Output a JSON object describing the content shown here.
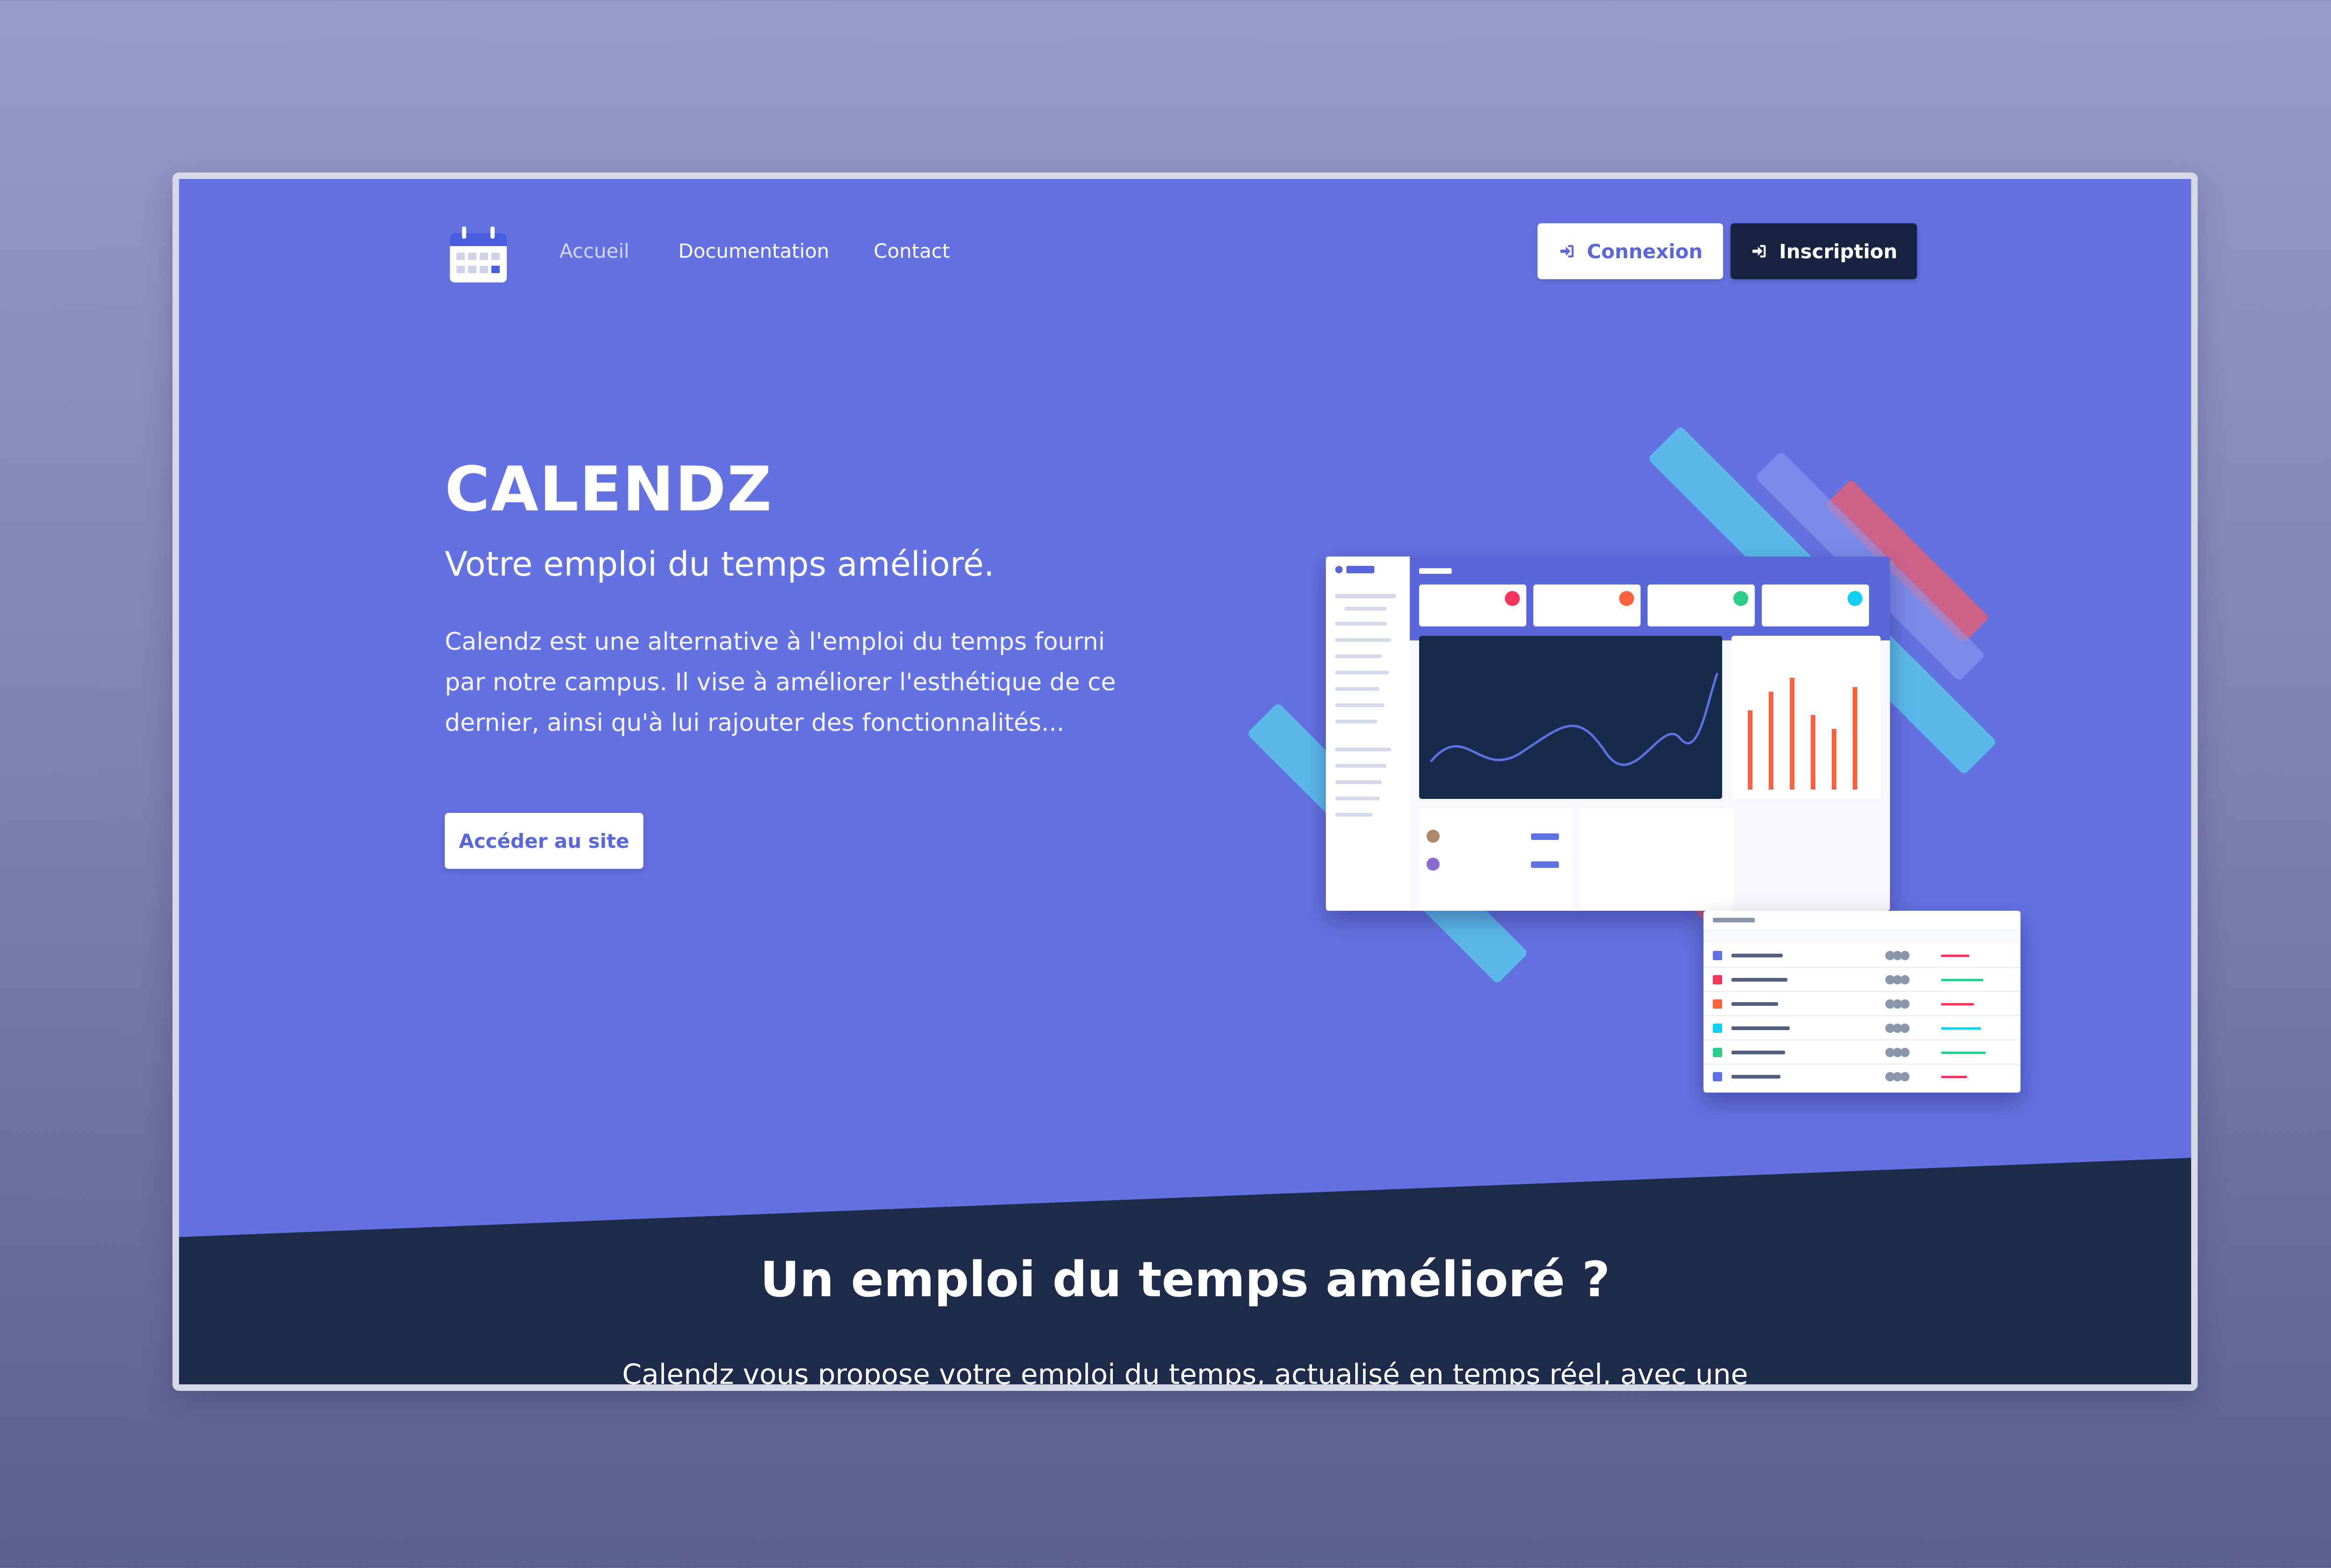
{
  "colors": {
    "hero_bg": "#6471e0",
    "dark_bg": "#1d2a4a",
    "accent": "#5a67d8",
    "button_dark": "#172340",
    "page_bg_top": "#969bc9",
    "page_bg_bottom": "#5a5f8e"
  },
  "nav": {
    "logo_icon": "calendar-icon",
    "links": [
      {
        "label": "Accueil"
      },
      {
        "label": "Documentation"
      },
      {
        "label": "Contact"
      }
    ],
    "connexion_label": "Connexion",
    "inscription_label": "Inscription",
    "login_icon": "sign-in-icon"
  },
  "hero": {
    "title": "CALENDZ",
    "subtitle": "Votre emploi du temps amélioré.",
    "description": "Calendz est une alternative à l'emploi du temps fourni par notre campus. Il vise à améliorer l'esthétique de ce dernier, ainsi qu'à lui rajouter des fonctionnalités...",
    "cta_label": "Accéder au site",
    "illustration": "dashboard-preview-image"
  },
  "section2": {
    "title": "Un emploi du temps amélioré ?",
    "text": "Calendz vous propose votre emploi du temps, actualisé en temps réel, avec une"
  }
}
